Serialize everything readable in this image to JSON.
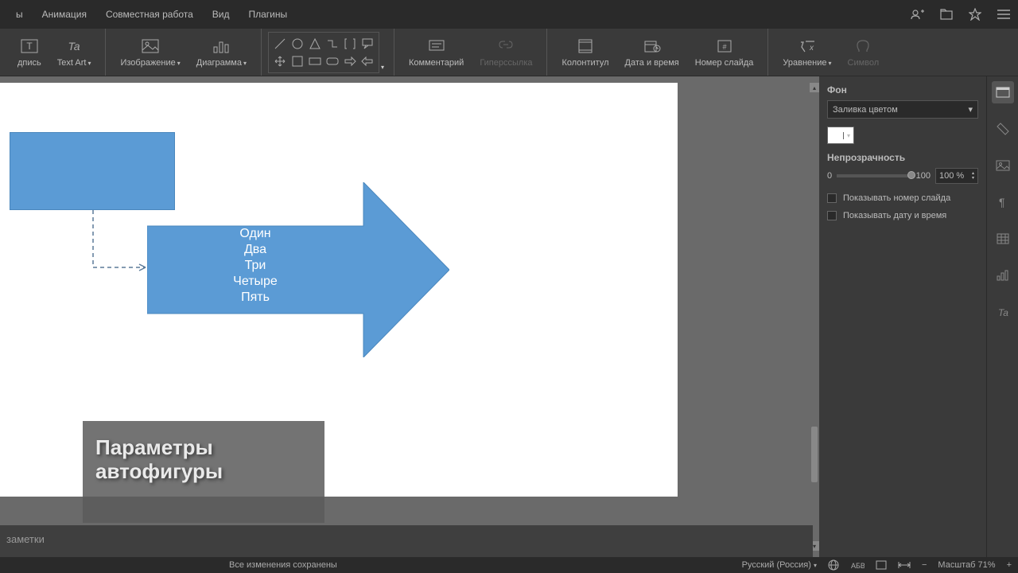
{
  "menubar": {
    "items": [
      "ы",
      "Анимация",
      "Совместная работа",
      "Вид",
      "Плагины"
    ]
  },
  "toolbar": {
    "textbox": "дпись",
    "textart": "Text Art",
    "image": "Изображение",
    "chart": "Диаграмма",
    "comment": "Комментарий",
    "hyperlink": "Гиперссылка",
    "headerfooter": "Колонтитул",
    "datetime": "Дата и время",
    "slidenum": "Номер слайда",
    "equation": "Уравнение",
    "symbol": "Символ"
  },
  "canvas": {
    "arrow_lines": [
      "Один",
      "Два",
      "Три",
      "Четыре",
      "Пять"
    ],
    "caption": "Параметры автофигуры"
  },
  "rightpanel": {
    "bg_label": "Фон",
    "fill_type": "Заливка цветом",
    "opacity_label": "Непрозрачность",
    "slider_min": "0",
    "slider_max": "100",
    "opacity_value": "100 %",
    "show_slidenum": "Показывать номер слайда",
    "show_datetime": "Показывать дату и время"
  },
  "notes": "заметки",
  "statusbar": {
    "saved": "Все изменения сохранены",
    "lang": "Русский (Россия)",
    "zoom_label": "Масштаб 71%"
  }
}
